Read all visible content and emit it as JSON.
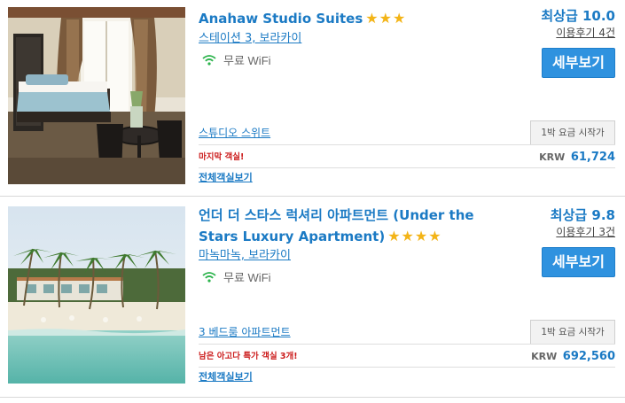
{
  "hotels": [
    {
      "name": "Anahaw Studio Suites",
      "stars": "★★★",
      "location": "스테이션 3, 보라카이",
      "amenity": "무료 WiFi",
      "score": "최상급 10.0",
      "reviews": "이용후기 4건",
      "detail_button": "세부보기",
      "room_type": "스튜디오 스위트",
      "price_label": "1박 요금 시작가",
      "alert": "마지막 객실!",
      "currency": "KRW",
      "price": "61,724",
      "all_rooms": "전체객실보기"
    },
    {
      "name_line1": "언더 더 스타스 럭셔리 아파트먼트 (Under the",
      "name_line2": "Stars Luxury Apartment)",
      "stars": "★★★★",
      "location": "마녹마녹, 보라카이",
      "amenity": "무료 WiFi",
      "score": "최상급 9.8",
      "reviews": "이용후기 3건",
      "detail_button": "세부보기",
      "room_type": "3 베드룸 아파트먼트",
      "price_label": "1박 요금 시작가",
      "alert": "남은 아고다 특가 객실 3개!",
      "currency": "KRW",
      "price": "692,560",
      "all_rooms": "전체객실보기"
    }
  ],
  "colors": {
    "link_blue": "#1b7ac4",
    "button_blue": "#2f92df",
    "star_gold": "#f3b417",
    "alert_red": "#cc1d1d",
    "wifi_green": "#2bb34b"
  }
}
